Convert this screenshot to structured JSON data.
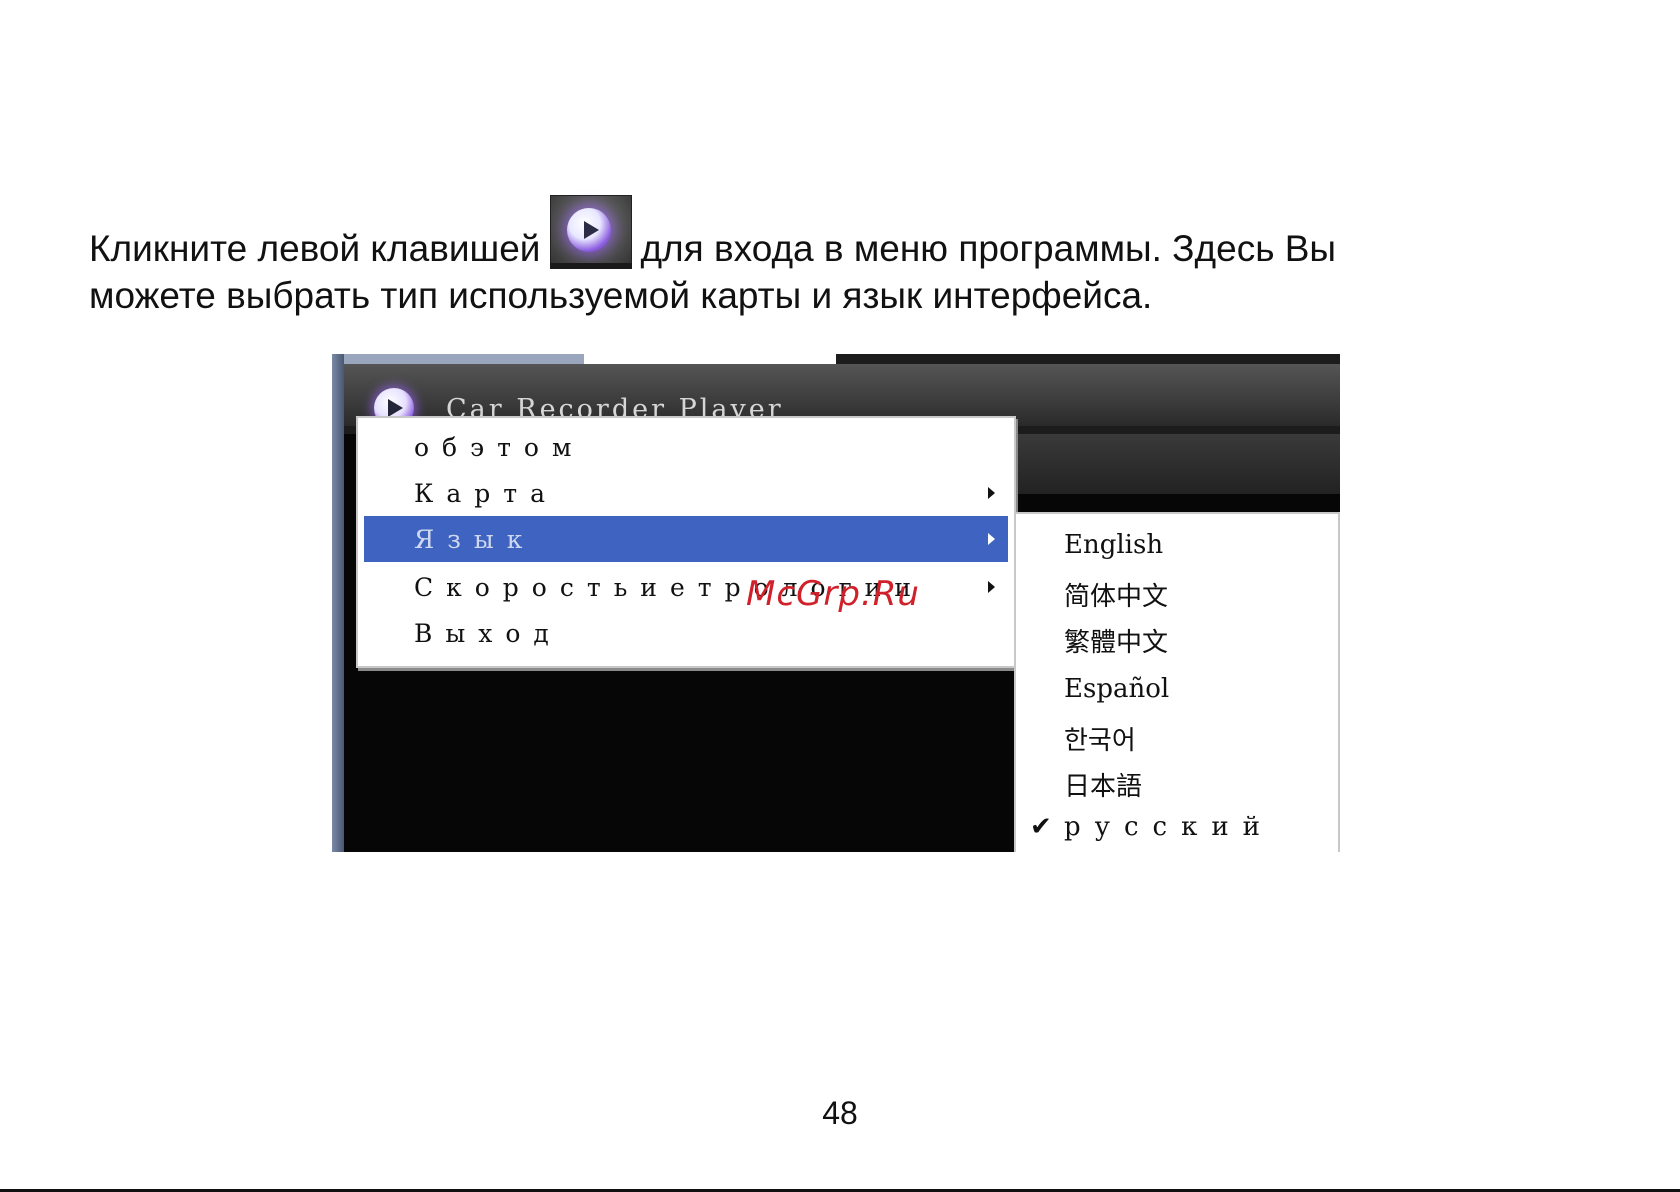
{
  "instruction": {
    "line1_before_icon": "Кликните левой клавишей",
    "line1_after_icon": "для входа в меню программы.  Здесь Вы",
    "line2": "можете выбрать тип используемой карты и язык интерфейса.",
    "icon": "play-button-icon"
  },
  "app": {
    "title": "Car Recorder Player",
    "logo_icon": "play-logo-icon"
  },
  "context_menu": {
    "items": [
      {
        "label": "обэтом",
        "has_submenu": false
      },
      {
        "label": "Карта",
        "has_submenu": true
      },
      {
        "label": "Язык",
        "has_submenu": true,
        "highlighted": true
      },
      {
        "label": "Скоростьиетрологии",
        "has_submenu": true
      },
      {
        "label": "Выход",
        "has_submenu": false
      }
    ],
    "highlight_color": "#3e63c0"
  },
  "language_submenu": {
    "items": [
      {
        "label": "English"
      },
      {
        "label": "简体中文"
      },
      {
        "label": "繁體中文"
      },
      {
        "label": "Español"
      },
      {
        "label": "한국어"
      },
      {
        "label": "日本語"
      },
      {
        "label": "русский",
        "checked": true
      }
    ],
    "check_mark": "✔"
  },
  "watermark": {
    "text": "McGrp.Ru",
    "color": "#d0202a"
  },
  "page_number": "48"
}
